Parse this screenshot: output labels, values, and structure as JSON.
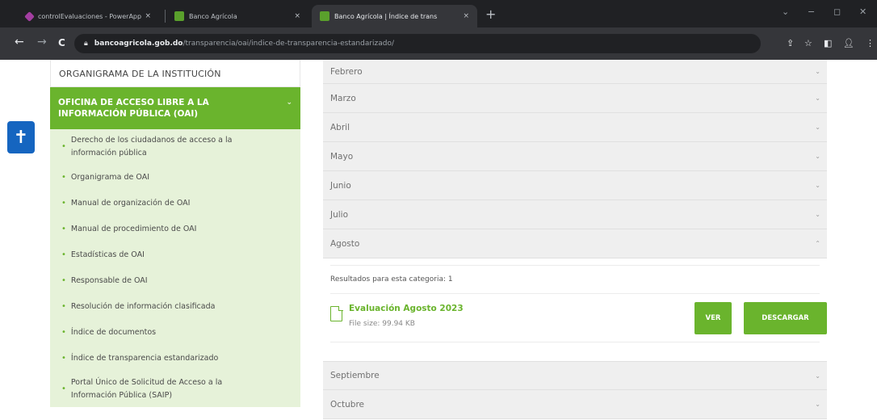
{
  "browser": {
    "tabs": [
      {
        "label": "controlEvaluaciones - PowerApp",
        "close": "×"
      },
      {
        "label": "Banco Agrícola",
        "close": "×"
      },
      {
        "label": "Banco Agrícola | Índice de trans",
        "close": "×"
      }
    ],
    "new_tab": "+",
    "window_controls": {
      "chevron": "⌄",
      "minimize": "−",
      "restore": "◻",
      "close": "✕"
    },
    "nav": {
      "back": "←",
      "forward": "→",
      "reload": "C"
    },
    "url_domain": "bancoagricola.gob.do",
    "url_path": "/transparencia/oai/indice-de-transparencia-estandarizado/",
    "colors": {
      "chrome_dark": "#202124",
      "chrome_toolbar": "#35363a"
    }
  },
  "accessibility": {
    "icon": "accessibility-icon",
    "glyph": "✝"
  },
  "sidebar": {
    "header": "ORGANIGRAMA DE LA INSTITUCIÓN",
    "active": {
      "label": "OFICINA DE ACCESO LIBRE A LA INFORMACIÓN PÚBLICA (OAI)",
      "chevron": "⌄"
    },
    "items": [
      {
        "label": "Derecho de los ciudadanos de acceso a la información pública"
      },
      {
        "label": "Organigrama de OAI"
      },
      {
        "label": "Manual de organización de OAI"
      },
      {
        "label": "Manual de procedimiento de OAI"
      },
      {
        "label": "Estadísticas de OAI"
      },
      {
        "label": "Responsable de OAI"
      },
      {
        "label": "Resolución de información clasificada"
      },
      {
        "label": "Índice de documentos"
      },
      {
        "label": "Índice de transparencia estandarizado"
      },
      {
        "label": "Portal Único de Solicitud de Acceso a la Información Pública (SAIP)"
      }
    ],
    "bullet": "•",
    "colors": {
      "accent": "#6ab42d",
      "list_bg": "#e6f2d9"
    }
  },
  "content": {
    "months_before": [
      "Febrero",
      "Marzo",
      "Abril",
      "Mayo",
      "Junio",
      "Julio"
    ],
    "expanded_month": "Agosto",
    "results_text": "Resultados para esta categoria: 1",
    "document": {
      "title": "Evaluación Agosto 2023",
      "size": "File size: 99.94 KB",
      "ver_label": "VER",
      "download_label": "DESCARGAR"
    },
    "months_after": [
      "Septiembre",
      "Octubre"
    ],
    "chevron_down": "⌄",
    "chevron_up": "⌃"
  }
}
